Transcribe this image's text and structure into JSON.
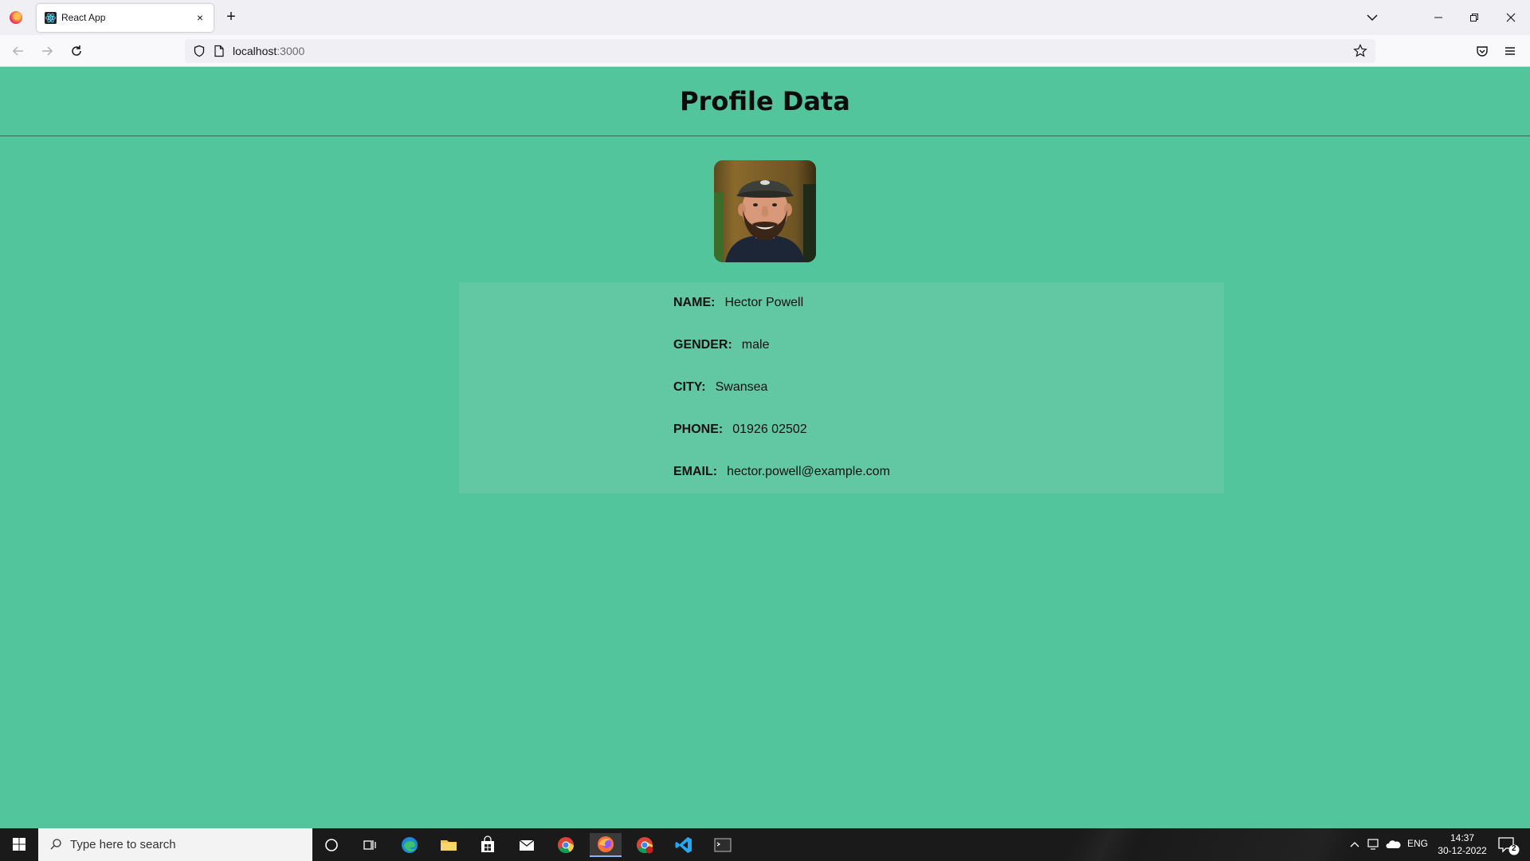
{
  "browser": {
    "tab_title": "React App",
    "tab_close": "×",
    "new_tab": "+",
    "url_host": "localhost",
    "url_port": ":3000"
  },
  "page": {
    "title": "Profile Data",
    "avatar_alt": "Profile photo",
    "fields": [
      {
        "label": "NAME:",
        "value": "Hector Powell"
      },
      {
        "label": "GENDER:",
        "value": "male"
      },
      {
        "label": "CITY:",
        "value": "Swansea"
      },
      {
        "label": "PHONE:",
        "value": "01926 02502"
      },
      {
        "label": "EMAIL:",
        "value": "hector.powell@example.com"
      }
    ]
  },
  "taskbar": {
    "search_placeholder": "Type here to search",
    "language": "ENG",
    "time": "14:37",
    "date": "30-12-2022",
    "notification_count": "2"
  },
  "colors": {
    "page_background": "#52c59d",
    "card_background": "#61c8a3"
  }
}
